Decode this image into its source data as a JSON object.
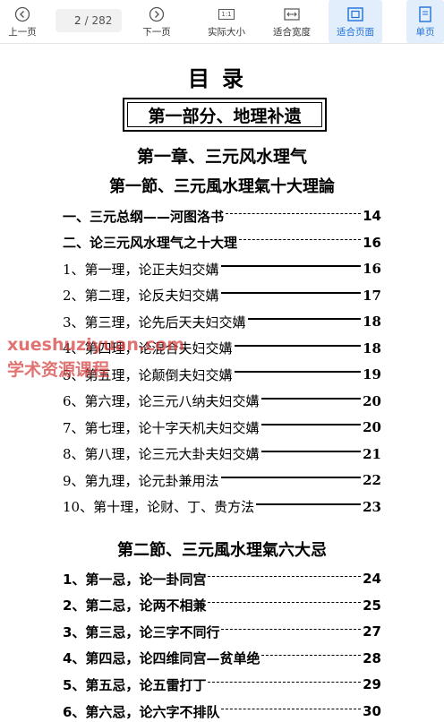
{
  "toolbar": {
    "prev_label": "上一页",
    "page_current": "2",
    "page_total": "/ 282",
    "next_label": "下一页",
    "actual_icon_text": "1:1",
    "actual_label": "实际大小",
    "fit_width_label": "适合宽度",
    "fit_page_label": "适合页面",
    "single_label": "单页",
    "accent": "#1d6fd8"
  },
  "doc": {
    "title": "目录",
    "part": "第一部分、地理补遗",
    "chapter": "第一章、三元风水理气",
    "section1": "第一節、三元風水理氣十大理論",
    "toc1": [
      {
        "label": "一、三元总纲——河图洛书",
        "page": "14"
      },
      {
        "label": "二、论三元风水理气之十大理",
        "page": "16"
      },
      {
        "label": "1、第一理，论正夫妇交媾",
        "page": "16"
      },
      {
        "label": "2、第二理，论反夫妇交媾",
        "page": "17"
      },
      {
        "label": "3、第三理，论先后天夫妇交媾",
        "page": "18"
      },
      {
        "label": "4、第四理，论混合夫妇交媾",
        "page": "18"
      },
      {
        "label": "5、第五理，论颠倒夫妇交媾",
        "page": "19"
      },
      {
        "label": "6、第六理，论三元八纳夫妇交媾",
        "page": "20"
      },
      {
        "label": "7、第七理，论十字天机夫妇交媾",
        "page": "20"
      },
      {
        "label": "8、第八理，论三元大卦夫妇交媾",
        "page": "21"
      },
      {
        "label": "9、第九理，论元卦兼用法",
        "page": "22"
      },
      {
        "label": "10、第十理，论财、丁、贵方法",
        "page": "23"
      }
    ],
    "section2": "第二節、三元風水理氣六大忌",
    "toc2": [
      {
        "label": "1、第一忌，论一卦同宫",
        "page": "24"
      },
      {
        "label": "2、第二忌，论两不相兼",
        "page": "25"
      },
      {
        "label": "3、第三忌，论三字不同行",
        "page": "27"
      },
      {
        "label": "4、第四忌，论四维同宫—贫单绝",
        "page": "28"
      },
      {
        "label": "5、第五忌，论五雷打丁",
        "page": "29"
      },
      {
        "label": "6、第六忌，论六字不排队",
        "page": "30"
      }
    ],
    "watermark_line1": "xueshuziyuan.com",
    "watermark_line2": "学术资源课程"
  }
}
